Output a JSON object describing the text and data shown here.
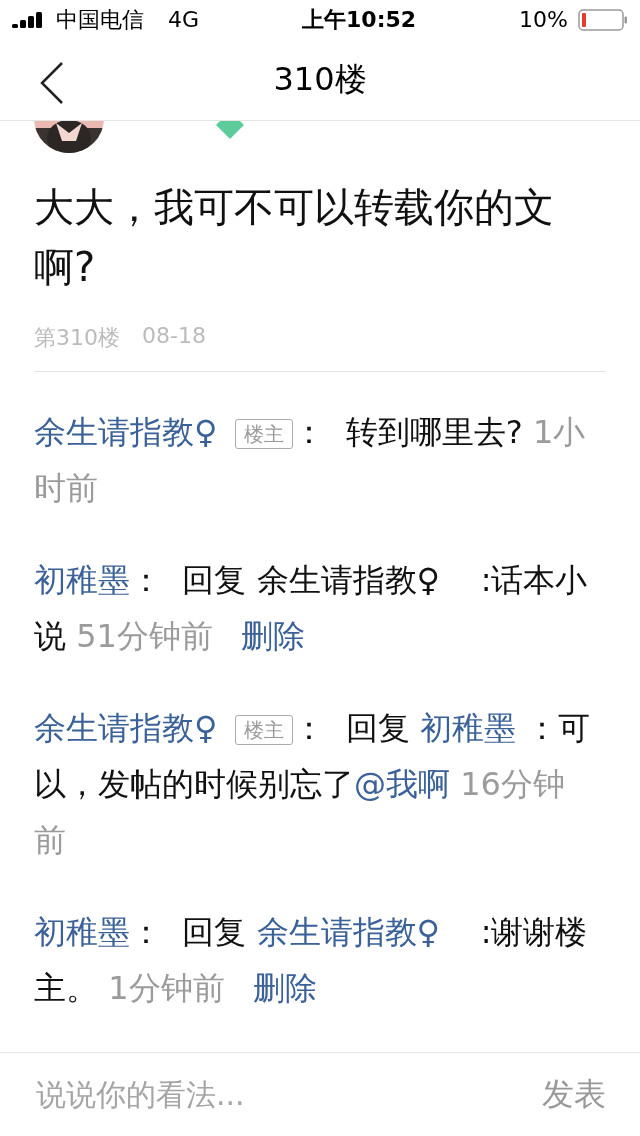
{
  "status_bar": {
    "carrier": "中国电信",
    "network": "4G",
    "time": "上午10:52",
    "battery": "10%"
  },
  "nav": {
    "title": "310楼"
  },
  "post": {
    "verified": true,
    "content": "大大，我可不可以转载你的文啊?",
    "floor": "第310楼",
    "date": "08-18"
  },
  "comments": [
    {
      "author": "余生请指教♀",
      "badge": "楼主",
      "parts": [
        {
          "kind": "text",
          "text": "：  转到哪里去?"
        }
      ],
      "time": "1小时前"
    },
    {
      "author": "初稚墨",
      "parts": [
        {
          "kind": "text",
          "text": "：  回复 余生请指教♀    :话本小说"
        }
      ],
      "time": "51分钟前",
      "action": "删除"
    },
    {
      "author": "余生请指教♀",
      "badge": "楼主",
      "parts": [
        {
          "kind": "text",
          "text": "：  回复 "
        },
        {
          "kind": "link",
          "text": "初稚墨"
        },
        {
          "kind": "text",
          "text": " ：可以，发帖的时候别忘了"
        },
        {
          "kind": "link",
          "text": "@我啊"
        }
      ],
      "time": "16分钟前"
    },
    {
      "author": "初稚墨",
      "parts": [
        {
          "kind": "text",
          "text": "：  回复 "
        },
        {
          "kind": "link",
          "text": "余生请指教♀"
        },
        {
          "kind": "text",
          "text": "    :谢谢楼主。"
        }
      ],
      "time": "1分钟前",
      "action": "删除"
    }
  ],
  "composer": {
    "placeholder": "说说你的看法...",
    "send": "发表"
  }
}
